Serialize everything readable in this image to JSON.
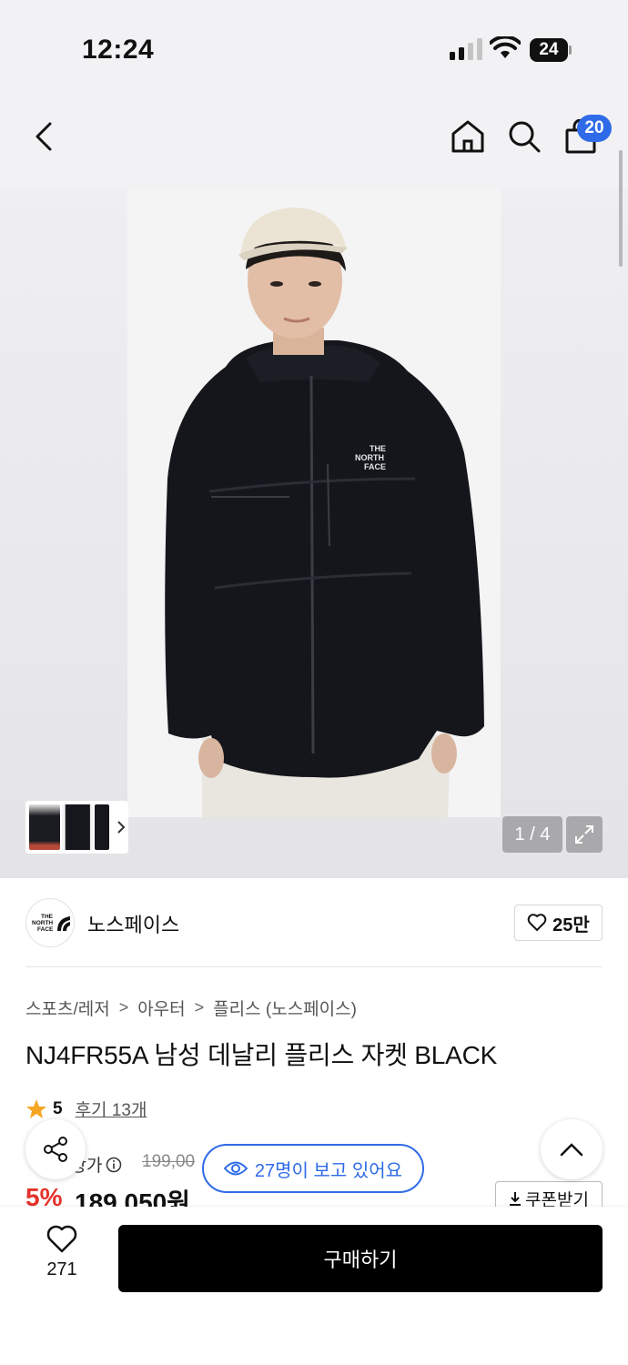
{
  "status_bar": {
    "time": "12:24",
    "battery": "24"
  },
  "nav": {
    "back_icon": "chevron-left-icon",
    "home_icon": "home-icon",
    "search_icon": "search-icon",
    "cart_icon": "shopping-bag-icon",
    "cart_count": "20"
  },
  "gallery": {
    "counter": "1 / 4",
    "expand_icon": "expand-icon",
    "thumbnail_chevron": "chevron-right-icon",
    "logo_on_jacket": "THE NORTH FACE"
  },
  "brand": {
    "logo_text": "THE NORTH FACE",
    "name": "노스페이스",
    "likes": "25만"
  },
  "breadcrumb": [
    "스포츠/레저",
    "아우터",
    "플리스 (노스페이스)"
  ],
  "product": {
    "title": "NJ4FR55A 남성 데날리 플리스 자켓 BLACK",
    "rating": "5",
    "reviews": "후기 13개",
    "price_label": "정상가",
    "original_price": "199,00",
    "discount": "5%",
    "final_price": "189,050원",
    "coupon_label": "쿠폰받기"
  },
  "floating": {
    "viewers": "27명이 보고 있어요"
  },
  "bottom": {
    "wish_count": "271",
    "buy_label": "구매하기"
  },
  "colors": {
    "accent": "#2f6be8",
    "discount": "#e4322b",
    "star": "#f5a623"
  }
}
